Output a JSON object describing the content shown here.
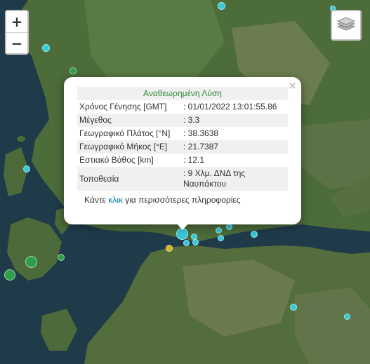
{
  "map": {
    "zoom_in_label": "+",
    "zoom_out_label": "−",
    "layers_icon": "layers-icon",
    "colors": {
      "quake_cyan": "#35c8d8",
      "quake_green": "#2e9e48",
      "quake_yellow": "#d6b224",
      "sea": "#1f3b4a",
      "land": "#496a3a"
    }
  },
  "popup": {
    "close_symbol": "×",
    "header": "Αναθεωρημένη Λύση",
    "rows": [
      {
        "label": "Χρόνος Γένησης [GMT]",
        "value": ": 01/01/2022 13:01:55.86"
      },
      {
        "label": "Μέγεθος",
        "value": ": 3.3"
      },
      {
        "label": "Γεωγραφικό Πλάτος [°N]",
        "value": ": 38.3638"
      },
      {
        "label": "Γεωγραφικό Μήκος [°E]",
        "value": ": 21.7387"
      },
      {
        "label": "Εστιακό Βάθος [km]",
        "value": ": 12.1"
      },
      {
        "label": "Τοποθεσία",
        "value": ": 9 Χλμ. ΔΝΔ της Ναυπάκτου"
      }
    ],
    "more_prefix": "Κάντε ",
    "more_link": "κλικ",
    "more_suffix": " για περισσότερες πληροφορίες"
  }
}
